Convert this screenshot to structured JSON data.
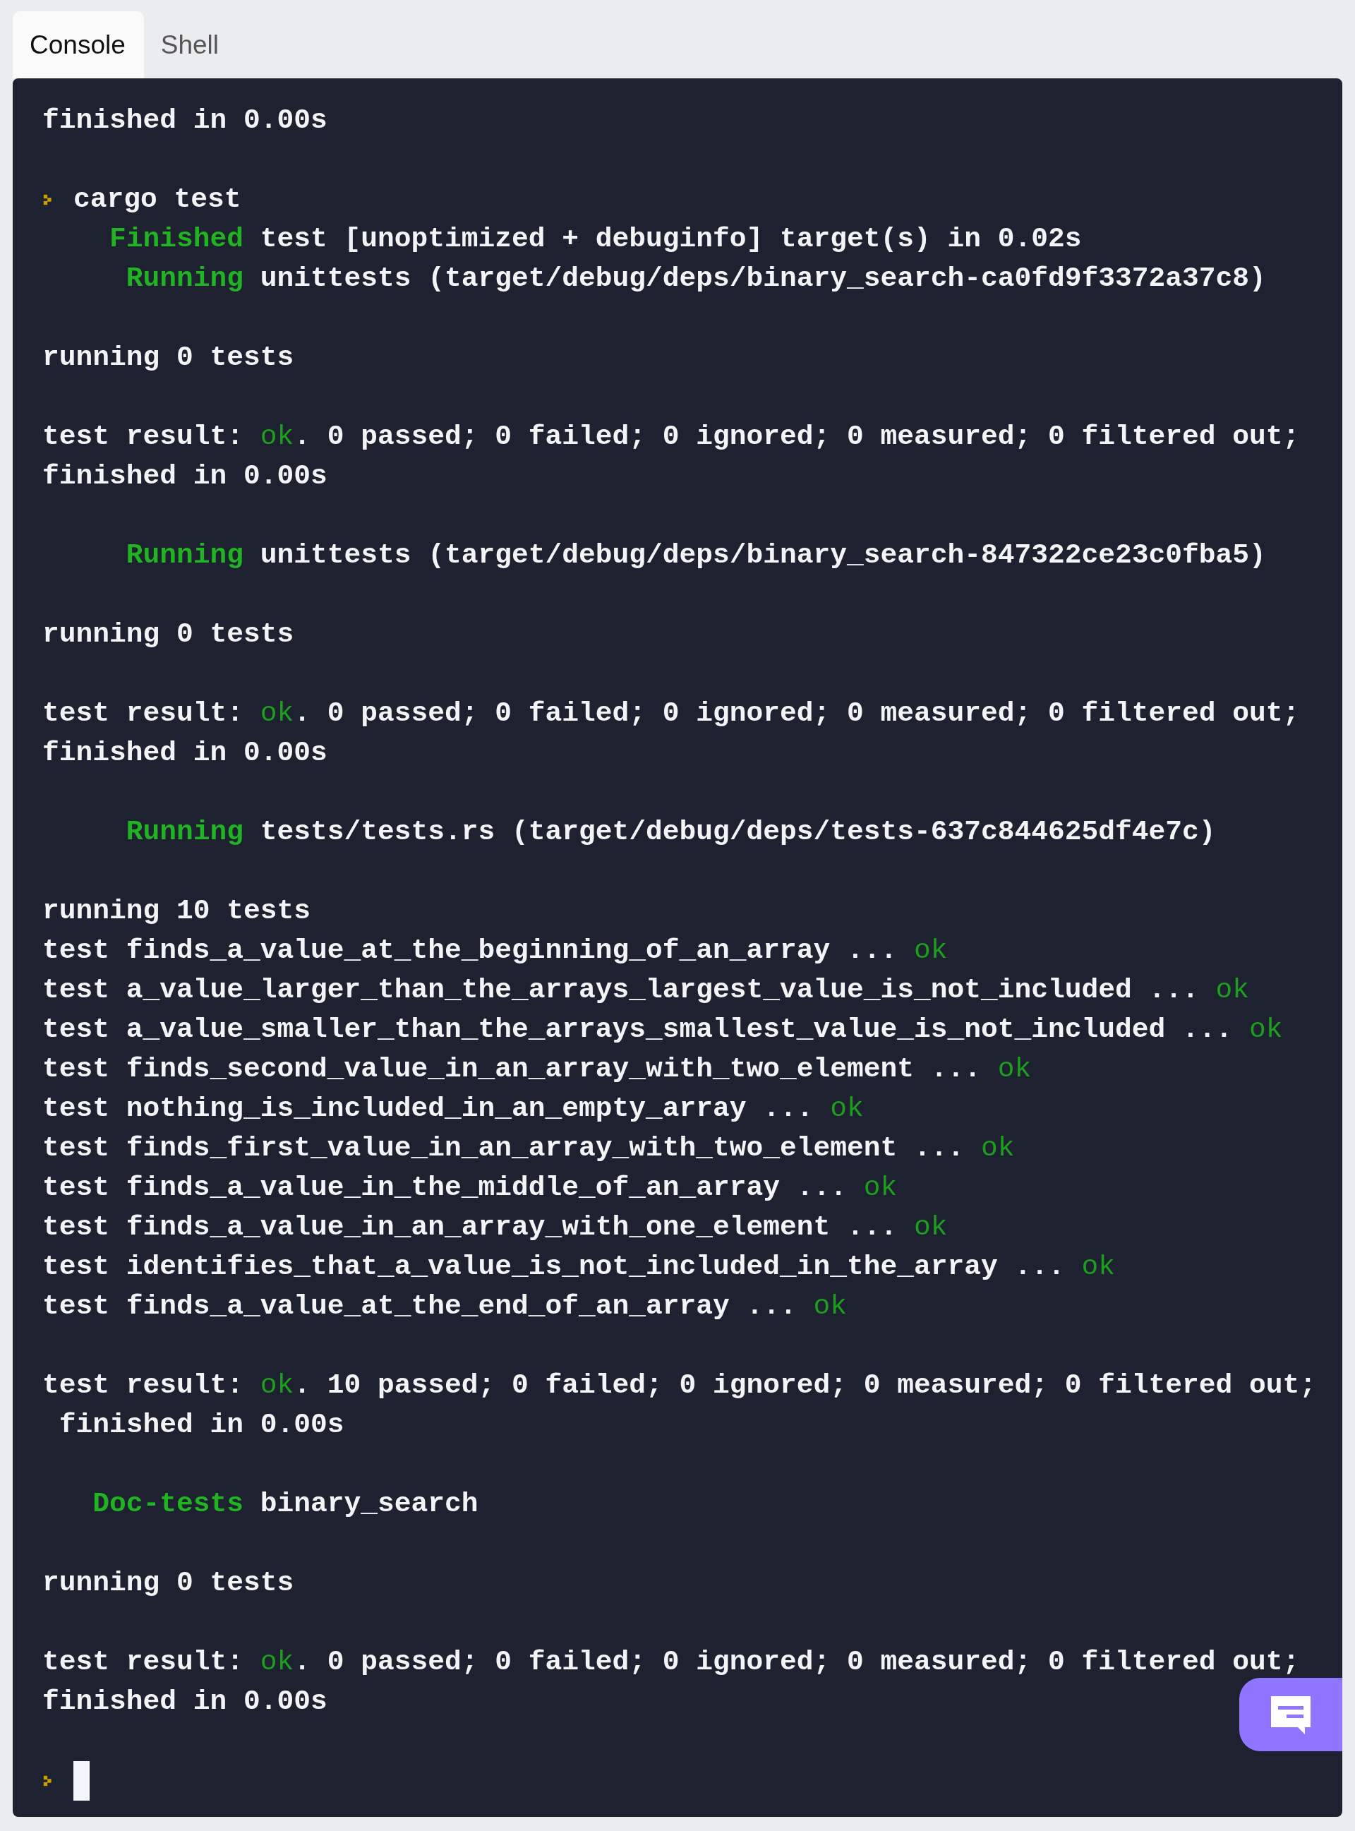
{
  "tabs": [
    {
      "label": "Console",
      "selected": true
    },
    {
      "label": "Shell",
      "selected": false
    }
  ],
  "console": {
    "blocks": [
      [
        {
          "kind": "output",
          "parts": [
            {
              "text": "finished in 0.00s",
              "kind": "plain"
            }
          ]
        }
      ],
      [
        {
          "kind": "prompt",
          "parts": [
            {
              "text": "cargo test",
              "kind": "plain"
            }
          ]
        },
        {
          "kind": "output",
          "parts": [
            {
              "text": "    Finished",
              "kind": "green"
            },
            {
              "text": " test [unoptimized + debuginfo] target(s) in 0.02s",
              "kind": "plain"
            }
          ]
        },
        {
          "kind": "output",
          "parts": [
            {
              "text": "     Running",
              "kind": "green"
            },
            {
              "text": " unittests (target/debug/deps/binary_search-ca0fd9f3372a37c8)",
              "kind": "plain"
            }
          ]
        }
      ],
      [
        {
          "kind": "output",
          "parts": [
            {
              "text": "running 0 tests",
              "kind": "plain"
            }
          ]
        }
      ],
      [
        {
          "kind": "output",
          "parts": [
            {
              "text": "test result: ",
              "kind": "plain"
            },
            {
              "text": "ok",
              "kind": "ok"
            },
            {
              "text": ". 0 passed; 0 failed; 0 ignored; 0 measured; 0 filtered out;",
              "kind": "plain"
            }
          ]
        },
        {
          "kind": "output",
          "parts": [
            {
              "text": "finished in 0.00s",
              "kind": "plain"
            }
          ]
        }
      ],
      [
        {
          "kind": "output",
          "parts": [
            {
              "text": "     Running",
              "kind": "green"
            },
            {
              "text": " unittests (target/debug/deps/binary_search-847322ce23c0fba5)",
              "kind": "plain"
            }
          ]
        }
      ],
      [
        {
          "kind": "output",
          "parts": [
            {
              "text": "running 0 tests",
              "kind": "plain"
            }
          ]
        }
      ],
      [
        {
          "kind": "output",
          "parts": [
            {
              "text": "test result: ",
              "kind": "plain"
            },
            {
              "text": "ok",
              "kind": "ok"
            },
            {
              "text": ". 0 passed; 0 failed; 0 ignored; 0 measured; 0 filtered out;",
              "kind": "plain"
            }
          ]
        },
        {
          "kind": "output",
          "parts": [
            {
              "text": "finished in 0.00s",
              "kind": "plain"
            }
          ]
        }
      ],
      [
        {
          "kind": "output",
          "parts": [
            {
              "text": "     Running",
              "kind": "green"
            },
            {
              "text": " tests/tests.rs (target/debug/deps/tests-637c844625df4e7c)",
              "kind": "plain"
            }
          ]
        }
      ],
      [
        {
          "kind": "output",
          "parts": [
            {
              "text": "running 10 tests",
              "kind": "plain"
            }
          ]
        },
        {
          "kind": "output",
          "parts": [
            {
              "text": "test finds_a_value_at_the_beginning_of_an_array ... ",
              "kind": "plain"
            },
            {
              "text": "ok",
              "kind": "ok"
            }
          ]
        },
        {
          "kind": "output",
          "parts": [
            {
              "text": "test a_value_larger_than_the_arrays_largest_value_is_not_included ... ",
              "kind": "plain"
            },
            {
              "text": "ok",
              "kind": "ok"
            }
          ]
        },
        {
          "kind": "output",
          "parts": [
            {
              "text": "test a_value_smaller_than_the_arrays_smallest_value_is_not_included ... ",
              "kind": "plain"
            },
            {
              "text": "ok",
              "kind": "ok"
            }
          ]
        },
        {
          "kind": "output",
          "parts": [
            {
              "text": "test finds_second_value_in_an_array_with_two_element ... ",
              "kind": "plain"
            },
            {
              "text": "ok",
              "kind": "ok"
            }
          ]
        },
        {
          "kind": "output",
          "parts": [
            {
              "text": "test nothing_is_included_in_an_empty_array ... ",
              "kind": "plain"
            },
            {
              "text": "ok",
              "kind": "ok"
            }
          ]
        },
        {
          "kind": "output",
          "parts": [
            {
              "text": "test finds_first_value_in_an_array_with_two_element ... ",
              "kind": "plain"
            },
            {
              "text": "ok",
              "kind": "ok"
            }
          ]
        },
        {
          "kind": "output",
          "parts": [
            {
              "text": "test finds_a_value_in_the_middle_of_an_array ... ",
              "kind": "plain"
            },
            {
              "text": "ok",
              "kind": "ok"
            }
          ]
        },
        {
          "kind": "output",
          "parts": [
            {
              "text": "test finds_a_value_in_an_array_with_one_element ... ",
              "kind": "plain"
            },
            {
              "text": "ok",
              "kind": "ok"
            }
          ]
        },
        {
          "kind": "output",
          "parts": [
            {
              "text": "test identifies_that_a_value_is_not_included_in_the_array ... ",
              "kind": "plain"
            },
            {
              "text": "ok",
              "kind": "ok"
            }
          ]
        },
        {
          "kind": "output",
          "parts": [
            {
              "text": "test finds_a_value_at_the_end_of_an_array ... ",
              "kind": "plain"
            },
            {
              "text": "ok",
              "kind": "ok"
            }
          ]
        }
      ],
      [
        {
          "kind": "output",
          "parts": [
            {
              "text": "test result: ",
              "kind": "plain"
            },
            {
              "text": "ok",
              "kind": "ok"
            },
            {
              "text": ". 10 passed; 0 failed; 0 ignored; 0 measured; 0 filtered out;",
              "kind": "plain"
            }
          ]
        },
        {
          "kind": "output",
          "parts": [
            {
              "text": " finished in 0.00s",
              "kind": "plain"
            }
          ]
        }
      ],
      [
        {
          "kind": "output",
          "parts": [
            {
              "text": "   Doc-tests",
              "kind": "green"
            },
            {
              "text": " binary_search",
              "kind": "plain"
            }
          ]
        }
      ],
      [
        {
          "kind": "output",
          "parts": [
            {
              "text": "running 0 tests",
              "kind": "plain"
            }
          ]
        }
      ],
      [
        {
          "kind": "output",
          "parts": [
            {
              "text": "test result: ",
              "kind": "plain"
            },
            {
              "text": "ok",
              "kind": "ok"
            },
            {
              "text": ". 0 passed; 0 failed; 0 ignored; 0 measured; 0 filtered out;",
              "kind": "plain"
            }
          ]
        },
        {
          "kind": "output",
          "parts": [
            {
              "text": "finished in 0.00s",
              "kind": "plain"
            }
          ]
        }
      ],
      [
        {
          "kind": "input"
        }
      ]
    ]
  }
}
